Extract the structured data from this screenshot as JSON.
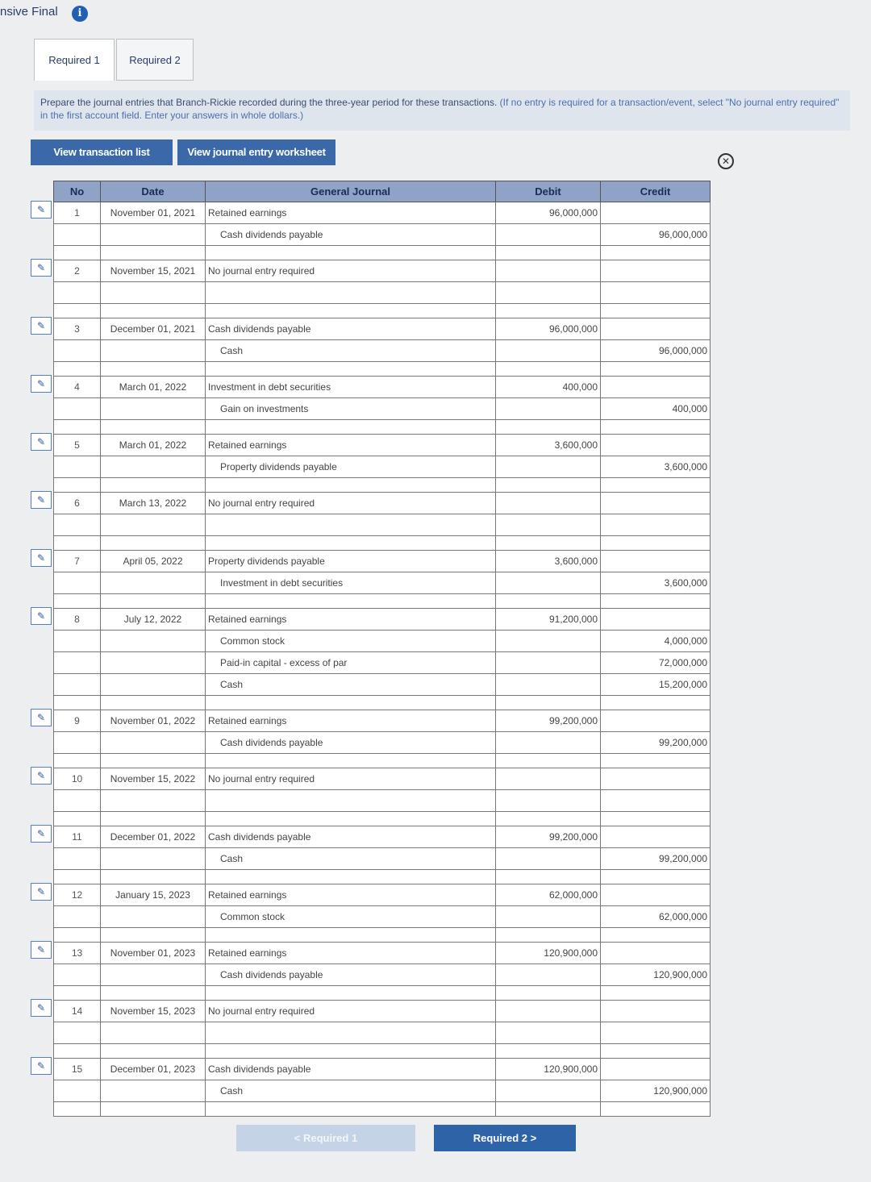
{
  "app": {
    "title": "nsive Final"
  },
  "tabs": [
    {
      "label": "Required 1"
    },
    {
      "label": "Required 2"
    }
  ],
  "instructions": {
    "text": "Prepare the journal entries that Branch-Rickie recorded during the three-year period for these transactions.",
    "hint": "(If no entry is required for a transaction/event, select \"No journal entry required\" in the first account field. Enter your answers in whole dollars.)"
  },
  "buttons": {
    "transaction_list": "View transaction list",
    "journal_worksheet": "View journal entry worksheet",
    "prev": "< Required 1",
    "next": "Required 2  >"
  },
  "columns": {
    "no": "No",
    "date": "Date",
    "journal": "General Journal",
    "debit": "Debit",
    "credit": "Credit"
  },
  "entries": [
    {
      "no": "1",
      "date": "November 01, 2021",
      "lines": [
        {
          "account": "Retained earnings",
          "debit": "96,000,000",
          "credit": ""
        },
        {
          "account": "Cash dividends payable",
          "debit": "",
          "credit": "96,000,000"
        }
      ]
    },
    {
      "no": "2",
      "date": "November 15, 2021",
      "lines": [
        {
          "account": "No journal entry required",
          "debit": "",
          "credit": ""
        }
      ]
    },
    {
      "no": "3",
      "date": "December 01, 2021",
      "lines": [
        {
          "account": "Cash dividends payable",
          "debit": "96,000,000",
          "credit": ""
        },
        {
          "account": "Cash",
          "debit": "",
          "credit": "96,000,000"
        }
      ]
    },
    {
      "no": "4",
      "date": "March 01, 2022",
      "lines": [
        {
          "account": "Investment in debt securities",
          "debit": "400,000",
          "credit": ""
        },
        {
          "account": "Gain on investments",
          "debit": "",
          "credit": "400,000"
        }
      ]
    },
    {
      "no": "5",
      "date": "March 01, 2022",
      "lines": [
        {
          "account": "Retained earnings",
          "debit": "3,600,000",
          "credit": ""
        },
        {
          "account": "Property dividends payable",
          "debit": "",
          "credit": "3,600,000"
        }
      ]
    },
    {
      "no": "6",
      "date": "March 13, 2022",
      "lines": [
        {
          "account": "No journal entry required",
          "debit": "",
          "credit": ""
        }
      ]
    },
    {
      "no": "7",
      "date": "April 05, 2022",
      "lines": [
        {
          "account": "Property dividends payable",
          "debit": "3,600,000",
          "credit": ""
        },
        {
          "account": "Investment in debt securities",
          "debit": "",
          "credit": "3,600,000"
        }
      ]
    },
    {
      "no": "8",
      "date": "July 12, 2022",
      "lines": [
        {
          "account": "Retained earnings",
          "debit": "91,200,000",
          "credit": ""
        },
        {
          "account": "Common stock",
          "debit": "",
          "credit": "4,000,000"
        },
        {
          "account": "Paid-in capital - excess of par",
          "debit": "",
          "credit": "72,000,000"
        },
        {
          "account": "Cash",
          "debit": "",
          "credit": "15,200,000"
        }
      ]
    },
    {
      "no": "9",
      "date": "November 01, 2022",
      "lines": [
        {
          "account": "Retained earnings",
          "debit": "99,200,000",
          "credit": ""
        },
        {
          "account": "Cash dividends payable",
          "debit": "",
          "credit": "99,200,000"
        }
      ]
    },
    {
      "no": "10",
      "date": "November 15, 2022",
      "lines": [
        {
          "account": "No journal entry required",
          "debit": "",
          "credit": ""
        }
      ]
    },
    {
      "no": "11",
      "date": "December 01, 2022",
      "lines": [
        {
          "account": "Cash dividends payable",
          "debit": "99,200,000",
          "credit": ""
        },
        {
          "account": "Cash",
          "debit": "",
          "credit": "99,200,000"
        }
      ]
    },
    {
      "no": "12",
      "date": "January 15, 2023",
      "lines": [
        {
          "account": "Retained earnings",
          "debit": "62,000,000",
          "credit": ""
        },
        {
          "account": "Common stock",
          "debit": "",
          "credit": "62,000,000"
        }
      ]
    },
    {
      "no": "13",
      "date": "November 01, 2023",
      "lines": [
        {
          "account": "Retained earnings",
          "debit": "120,900,000",
          "credit": ""
        },
        {
          "account": "Cash dividends payable",
          "debit": "",
          "credit": "120,900,000"
        }
      ]
    },
    {
      "no": "14",
      "date": "November 15, 2023",
      "lines": [
        {
          "account": "No journal entry required",
          "debit": "",
          "credit": ""
        }
      ]
    },
    {
      "no": "15",
      "date": "December 01, 2023",
      "lines": [
        {
          "account": "Cash dividends payable",
          "debit": "120,900,000",
          "credit": ""
        },
        {
          "account": "Cash",
          "debit": "",
          "credit": "120,900,000"
        }
      ]
    }
  ]
}
